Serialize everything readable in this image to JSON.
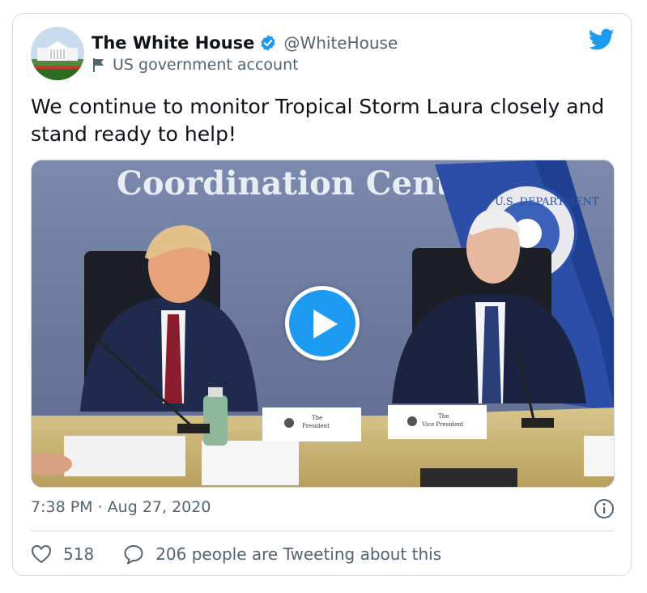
{
  "author": {
    "display_name": "The White House",
    "handle": "@WhiteHouse",
    "label": "US government account",
    "verified": true
  },
  "tweet": {
    "text": "We continue to monitor Tropical Storm Laura closely and stand ready to help!",
    "timestamp": "7:38 PM · Aug 27, 2020"
  },
  "media": {
    "type": "video",
    "wall_sign": "Coordination Center",
    "seal_text": "U.S. DEPARTMENT",
    "placards": {
      "left": [
        "The",
        "President"
      ],
      "right": [
        "The",
        "Vice President"
      ]
    }
  },
  "engagement": {
    "likes": "518",
    "reply_text": "206 people are Tweeting about this"
  },
  "colors": {
    "twitter_blue": "#1d9bf0",
    "secondary_text": "#536471",
    "border": "#cfd9de"
  },
  "icons": [
    "verified-icon",
    "flag-icon",
    "twitter-bird-icon",
    "play-icon",
    "info-icon",
    "heart-icon",
    "reply-icon"
  ]
}
